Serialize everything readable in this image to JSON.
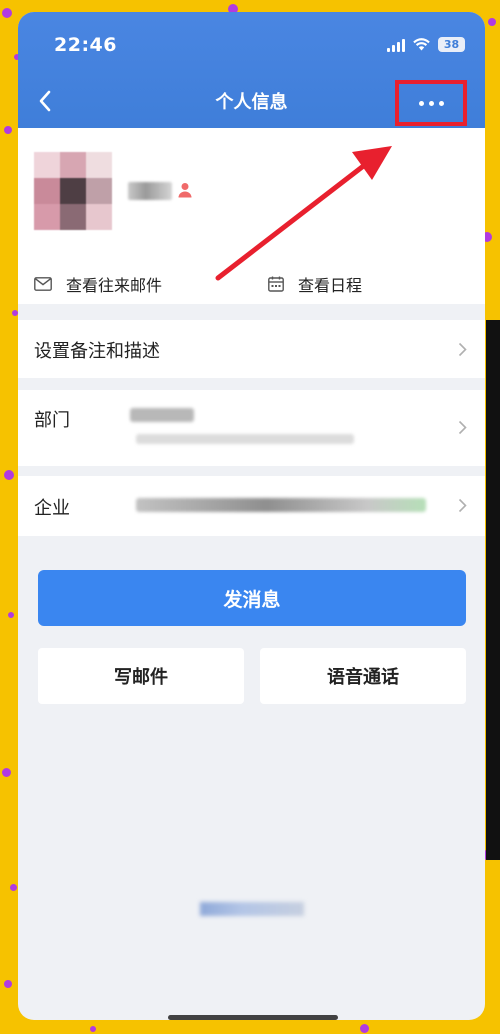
{
  "status_bar": {
    "time": "22:46",
    "battery": "38"
  },
  "header": {
    "title": "个人信息"
  },
  "profile": {
    "actions": [
      {
        "label": "查看往来邮件"
      },
      {
        "label": "查看日程"
      }
    ]
  },
  "rows": {
    "remark": "设置备注和描述",
    "department": "部门",
    "company": "企业"
  },
  "buttons": {
    "send_message": "发消息",
    "write_mail": "写邮件",
    "voice_call": "语音通话"
  },
  "colors": {
    "header_blue": "#3f7ed9",
    "primary_button": "#3a86f0",
    "highlight_red": "#e8202e",
    "frame_yellow": "#f6c200",
    "frame_dots": "#b13be0"
  }
}
